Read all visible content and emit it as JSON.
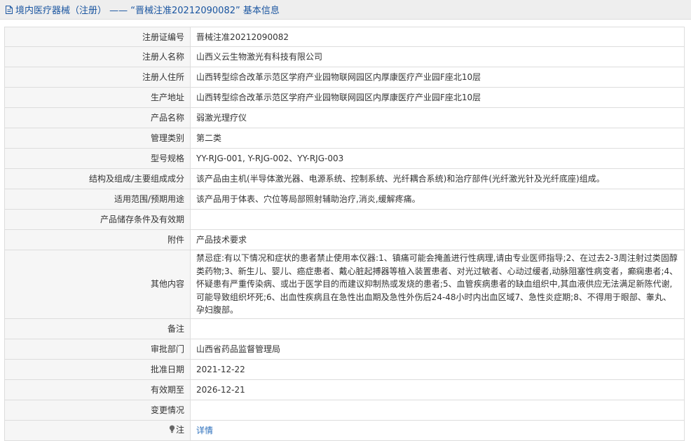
{
  "header": {
    "title": "境内医疗器械（注册） —— “晋械注准20212090082” 基本信息",
    "icon": "document-icon"
  },
  "rows": [
    {
      "label": "注册证编号",
      "value": "晋械注准20212090082"
    },
    {
      "label": "注册人名称",
      "value": "山西义云生物激光有科技有限公司"
    },
    {
      "label": "注册人住所",
      "value": "山西转型综合改革示范区学府产业园物联网园区内厚康医疗产业园F座北10层"
    },
    {
      "label": "生产地址",
      "value": "山西转型综合改革示范区学府产业园物联网园区内厚康医疗产业园F座北10层"
    },
    {
      "label": "产品名称",
      "value": "弱激光理疗仪"
    },
    {
      "label": "管理类别",
      "value": "第二类"
    },
    {
      "label": "型号规格",
      "value": "YY-RJG-001, Y-RJG-002、YY-RJG-003"
    },
    {
      "label": "结构及组成/主要组成成分",
      "value": "该产品由主机(半导体激光器、电源系统、控制系统、光纤耦合系统)和治疗部件(光纤激光针及光纤底座)组成。"
    },
    {
      "label": "适用范围/预期用途",
      "value": "该产品用于体表、穴位等局部照射辅助治疗,消炎,缓解疼痛。"
    },
    {
      "label": "产品储存条件及有效期",
      "value": ""
    },
    {
      "label": "附件",
      "value": "产品技术要求"
    },
    {
      "label": "其他内容",
      "value": "禁忌症:有以下情况和症状的患者禁止使用本仪器:1、镇痛可能会掩盖进行性病理,请由专业医师指导;2、在过去2-3周注射过类固醇类药物;3、新生儿、婴儿、癌症患者、戴心脏起搏器等植入装置患者、对光过敏者、心动过缓者,动脉阻塞性病变者，癫痫患者;4、怀疑患有严重传染病、或出于医学目的而建议抑制热或发烧的患者;5、血管疾病患者的缺血组织中,其血液供应无法满足新陈代谢,可能导致组织坏死;6、出血性疾病且在急性出血期及急性外伤后24-48小时内出血区域7、急性炎症期;8、不得用于眼部、睾丸、孕妇腹部。"
    },
    {
      "label": "备注",
      "value": ""
    },
    {
      "label": "审批部门",
      "value": "山西省药品监督管理局"
    },
    {
      "label": "批准日期",
      "value": "2021-12-22"
    },
    {
      "label": "有效期至",
      "value": "2026-12-21"
    },
    {
      "label": "变更情况",
      "value": ""
    }
  ],
  "note": {
    "label": "注",
    "icon": "lightbulb-icon",
    "link_text": "详情"
  }
}
